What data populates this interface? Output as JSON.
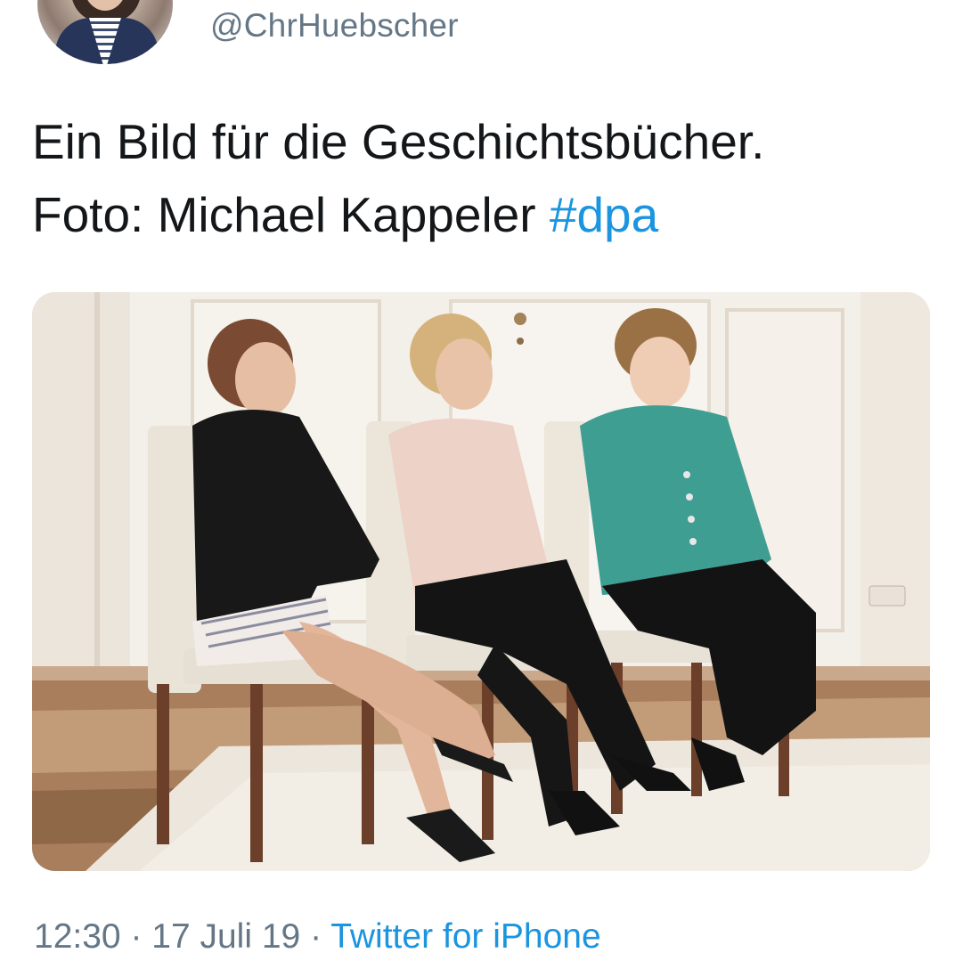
{
  "tweet": {
    "handle": "@ChrHuebscher",
    "text_line1": "Ein Bild für die Geschichtsbücher.",
    "text_line2_prefix": "Foto: Michael Kappeler ",
    "hashtag": "#dpa",
    "time": "12:30",
    "separator": " · ",
    "date": "17 Juli 19",
    "source": "Twitter for iPhone"
  },
  "colors": {
    "link": "#1b95e0",
    "secondary_text": "#657786",
    "primary_text": "#14171a"
  },
  "icons": {
    "avatar": "profile-photo"
  }
}
